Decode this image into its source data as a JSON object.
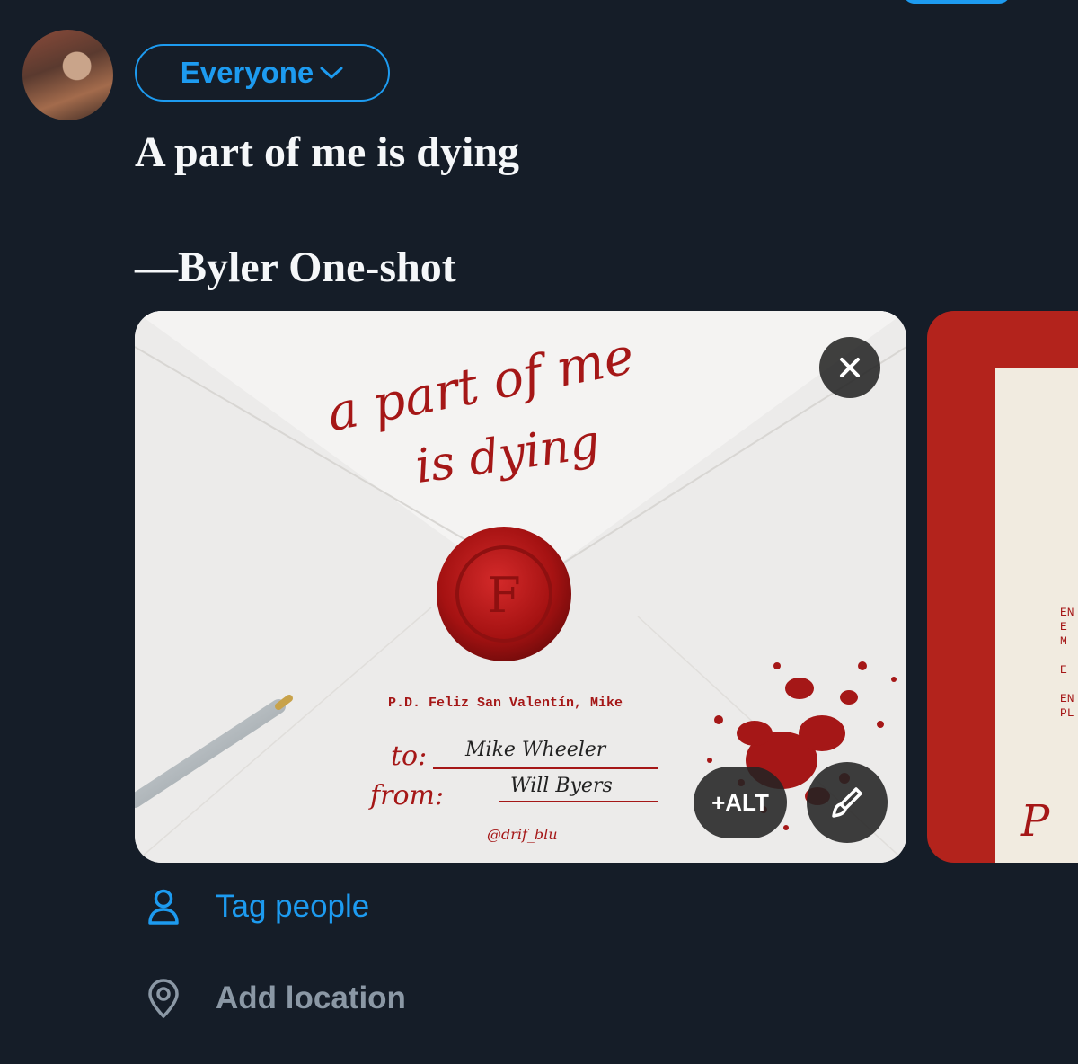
{
  "composer": {
    "audience_label": "Everyone",
    "text_lines": [
      "A part of me is dying",
      "",
      "—Byler One-shot"
    ]
  },
  "media": {
    "image1": {
      "title_line1": "a part of me",
      "title_line2": "is dying",
      "seal_letter": "F",
      "ps": "P.D. Feliz San Valentín, Mike",
      "to_label": "to:",
      "to_name": "Mike Wheeler",
      "from_label": "from:",
      "from_name": "Will Byers",
      "handle": "@drif_blu"
    },
    "image2": {
      "lines": [
        "EN",
        "E",
        "M",
        "",
        "E",
        "",
        "EN",
        "PL"
      ],
      "script": "P"
    },
    "alt_label": "+ALT"
  },
  "options": {
    "tag_label": "Tag people",
    "location_label": "Add location"
  },
  "colors": {
    "accent": "#1d9bf0",
    "background": "#151d28",
    "muted": "#8b98a5",
    "envelope_red": "#a51717"
  }
}
